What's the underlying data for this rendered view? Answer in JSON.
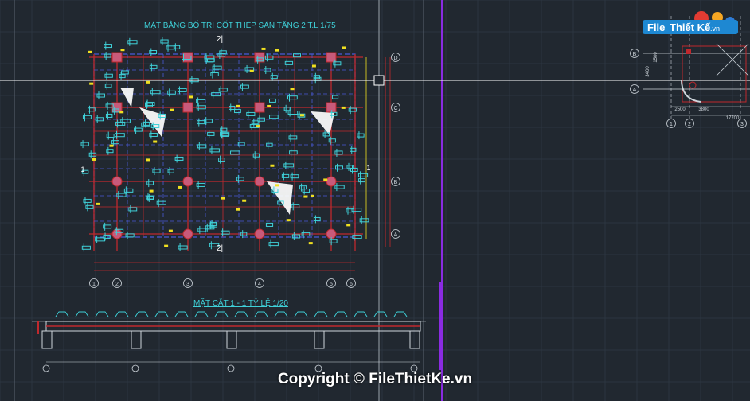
{
  "window": {
    "title": "FileThietKe CAD viewer"
  },
  "titles": {
    "plan": "MẶT BẰNG BỐ TRÍ CỐT THÉP SÀN TẦNG 2  T.L 1/75",
    "section": "MẶT CẮT 1 - 1  TỶ LỆ 1/20"
  },
  "section_marks": {
    "top": "2|",
    "bottom": "2|",
    "left": "1",
    "right": "1"
  },
  "grid_bottom": [
    "1",
    "2",
    "3",
    "4",
    "5",
    "6"
  ],
  "grid_right": [
    "D",
    "C",
    "B",
    "A"
  ],
  "inset": {
    "grid_rows": [
      "B",
      "A"
    ],
    "grid_cols": [
      "1",
      "2",
      "3"
    ],
    "dims_row": [
      "2500",
      "3800"
    ],
    "dims_total": "17700",
    "dims_left": [
      "1500",
      "3400"
    ]
  },
  "logo": {
    "file": "File",
    "name": "Thiết Kế",
    "tld": ".vn"
  },
  "copyright": "Copyright © FileThietKe.vn",
  "colors": {
    "background": "#212830",
    "grid": "#2c3540",
    "rebar_label": "#3fd0d8",
    "beam": "#c0282d",
    "axis_blue": "#4a5ad8",
    "yellow": "#f0e020",
    "crosshair": "#ffffff",
    "purple": "#8a2be2"
  }
}
